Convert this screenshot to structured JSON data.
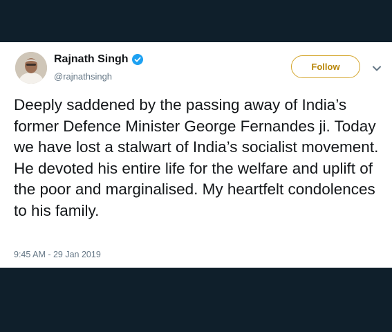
{
  "tweet": {
    "author": {
      "display_name": "Rajnath Singh",
      "handle": "@rajnathsingh",
      "verified": true,
      "verified_icon": "verified-badge-icon"
    },
    "follow_label": "Follow",
    "menu_icon": "chevron-down-icon",
    "text": "Deeply saddened by the passing away of India’s former Defence Minister George Fernandes ji. Today we have lost a stalwart of India’s socialist movement. He devoted his entire life for the welfare and uplift of the poor and marginalised. My heartfelt condolences to his family.",
    "timestamp": "9:45 AM - 29 Jan 2019"
  },
  "colors": {
    "background": "#0f1f2b",
    "card": "#ffffff",
    "accent_follow": "#d4a52a",
    "verified_blue": "#1da1f2",
    "secondary_text": "#657786"
  }
}
